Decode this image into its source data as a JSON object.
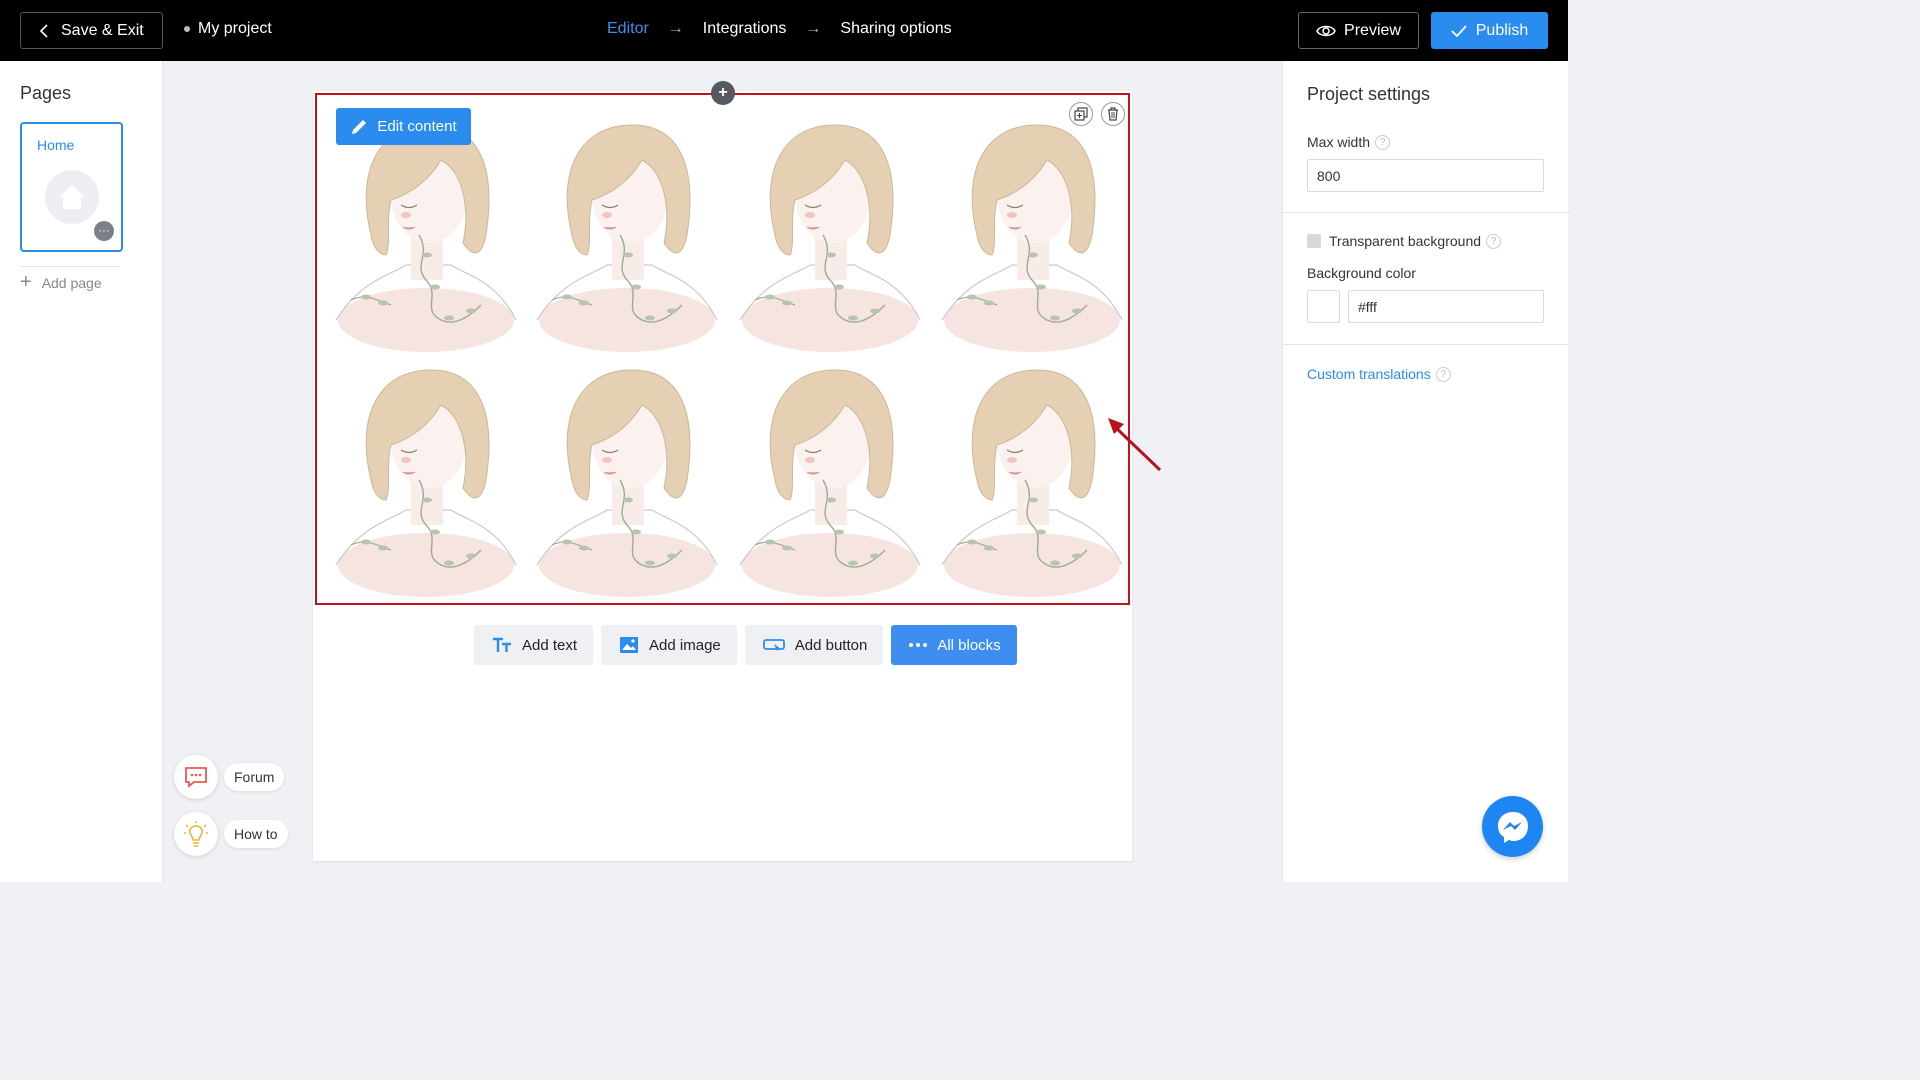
{
  "topbar": {
    "save_exit_label": "Save & Exit",
    "project_name": "My project",
    "steps": [
      "Editor",
      "Integrations",
      "Sharing options"
    ],
    "arrow_glyph": "→",
    "preview_label": "Preview",
    "publish_label": "Publish"
  },
  "pages_panel": {
    "title": "Pages",
    "pages": [
      {
        "label": "Home"
      }
    ],
    "more_glyph": "···",
    "add_page_label": "Add page"
  },
  "help": {
    "forum_label": "Forum",
    "howto_label": "How to"
  },
  "editor": {
    "edit_content_label": "Edit content",
    "add_handle_glyph": "+",
    "add_buttons": [
      "Add text",
      "Add image",
      "Add button",
      "All blocks"
    ]
  },
  "settings": {
    "title": "Project settings",
    "max_width_label": "Max width",
    "max_width_value": "800",
    "transparent_bg_label": "Transparent background",
    "transparent_bg_checked": false,
    "bg_color_label": "Background color",
    "bg_color_value": "#fff",
    "custom_translations_label": "Custom translations",
    "help_glyph": "?"
  },
  "colors": {
    "accent": "#2b8cf0",
    "highlight_border": "#c1121f",
    "topbar_bg": "#000000"
  },
  "icons": [
    "chevron-left-icon",
    "eye-icon",
    "check-icon",
    "home-icon",
    "forum-icon",
    "lightbulb-icon",
    "pencil-icon",
    "duplicate-icon",
    "trash-icon",
    "text-icon",
    "image-icon",
    "button-icon",
    "dots-icon",
    "messenger-icon",
    "plus-icon",
    "help-icon"
  ]
}
